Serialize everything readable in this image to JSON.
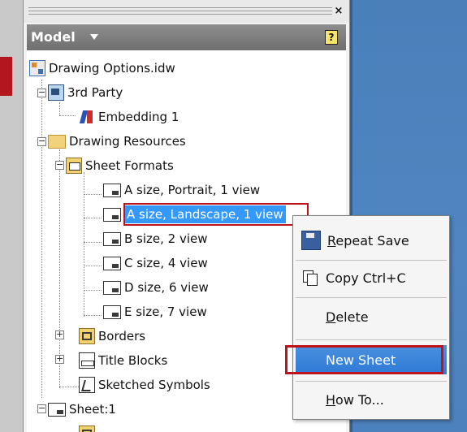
{
  "panel": {
    "close_glyph": "×",
    "title": "Model",
    "help_glyph": "?"
  },
  "tree": {
    "root": "Drawing Options.idw",
    "third_party": "3rd Party",
    "embedding": "Embedding 1",
    "drawing_resources": "Drawing Resources",
    "sheet_formats": "Sheet Formats",
    "formats": [
      "A size, Portrait, 1 view",
      "A size, Landscape, 1 view",
      "B size, 2 view",
      "C size, 4 view",
      "D size, 6 view",
      "E size, 7 view"
    ],
    "borders": "Borders",
    "title_blocks": "Title Blocks",
    "sketched_symbols": "Sketched Symbols",
    "sheet": "Sheet:1"
  },
  "context_menu": {
    "repeat_save_u": "R",
    "repeat_save_rest": "epeat Save",
    "copy": "Copy  Ctrl+C",
    "delete_u": "D",
    "delete_rest": "elete",
    "new_sheet": "New Sheet",
    "how_to_u": "H",
    "how_to_rest": "ow To..."
  },
  "colors": {
    "selection": "#3399ff",
    "highlight_outline": "#c0121b",
    "header": "#7d7d7d",
    "background_blue": "#4f86c1"
  }
}
